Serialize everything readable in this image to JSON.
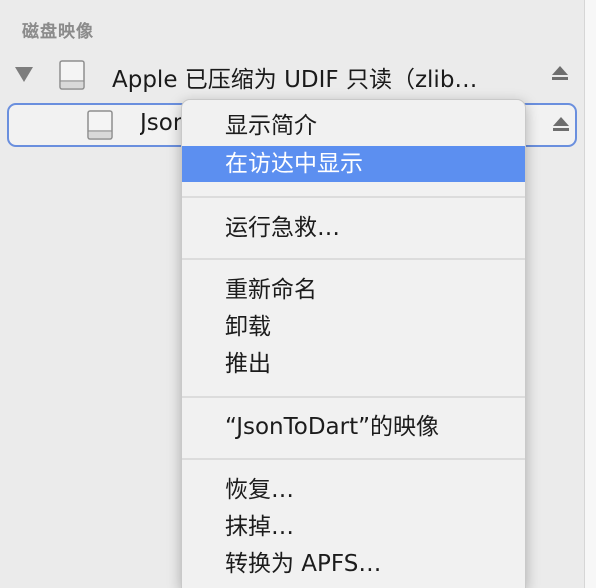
{
  "sidebar": {
    "section_title": "磁盘映像",
    "parent": {
      "label": "Apple 已压缩为 UDIF 只读（zlib…",
      "disclosure_icon": "disclosure-triangle-down-icon",
      "disk_icon": "disk-icon",
      "eject_icon": "eject-icon"
    },
    "child": {
      "label": "JsonToDart",
      "selected": true,
      "disk_icon": "disk-icon",
      "eject_icon": "eject-icon"
    }
  },
  "context_menu": {
    "items": [
      {
        "label": "显示简介",
        "highlighted": false
      },
      {
        "label": "在访达中显示",
        "highlighted": true
      },
      {
        "label": "运行急救…",
        "highlighted": false
      },
      {
        "label": "重新命名",
        "highlighted": false
      },
      {
        "label": "卸载",
        "highlighted": false
      },
      {
        "label": "推出",
        "highlighted": false
      },
      {
        "label": "“JsonToDart”的映像",
        "highlighted": false
      },
      {
        "label": "恢复…",
        "highlighted": false
      },
      {
        "label": "抹掉…",
        "highlighted": false
      },
      {
        "label": "转换为 APFS…",
        "highlighted": false
      }
    ]
  },
  "colors": {
    "highlight": "#5c8ff0",
    "selection_border": "#6a8fde",
    "section_title": "#8b8b8b"
  }
}
